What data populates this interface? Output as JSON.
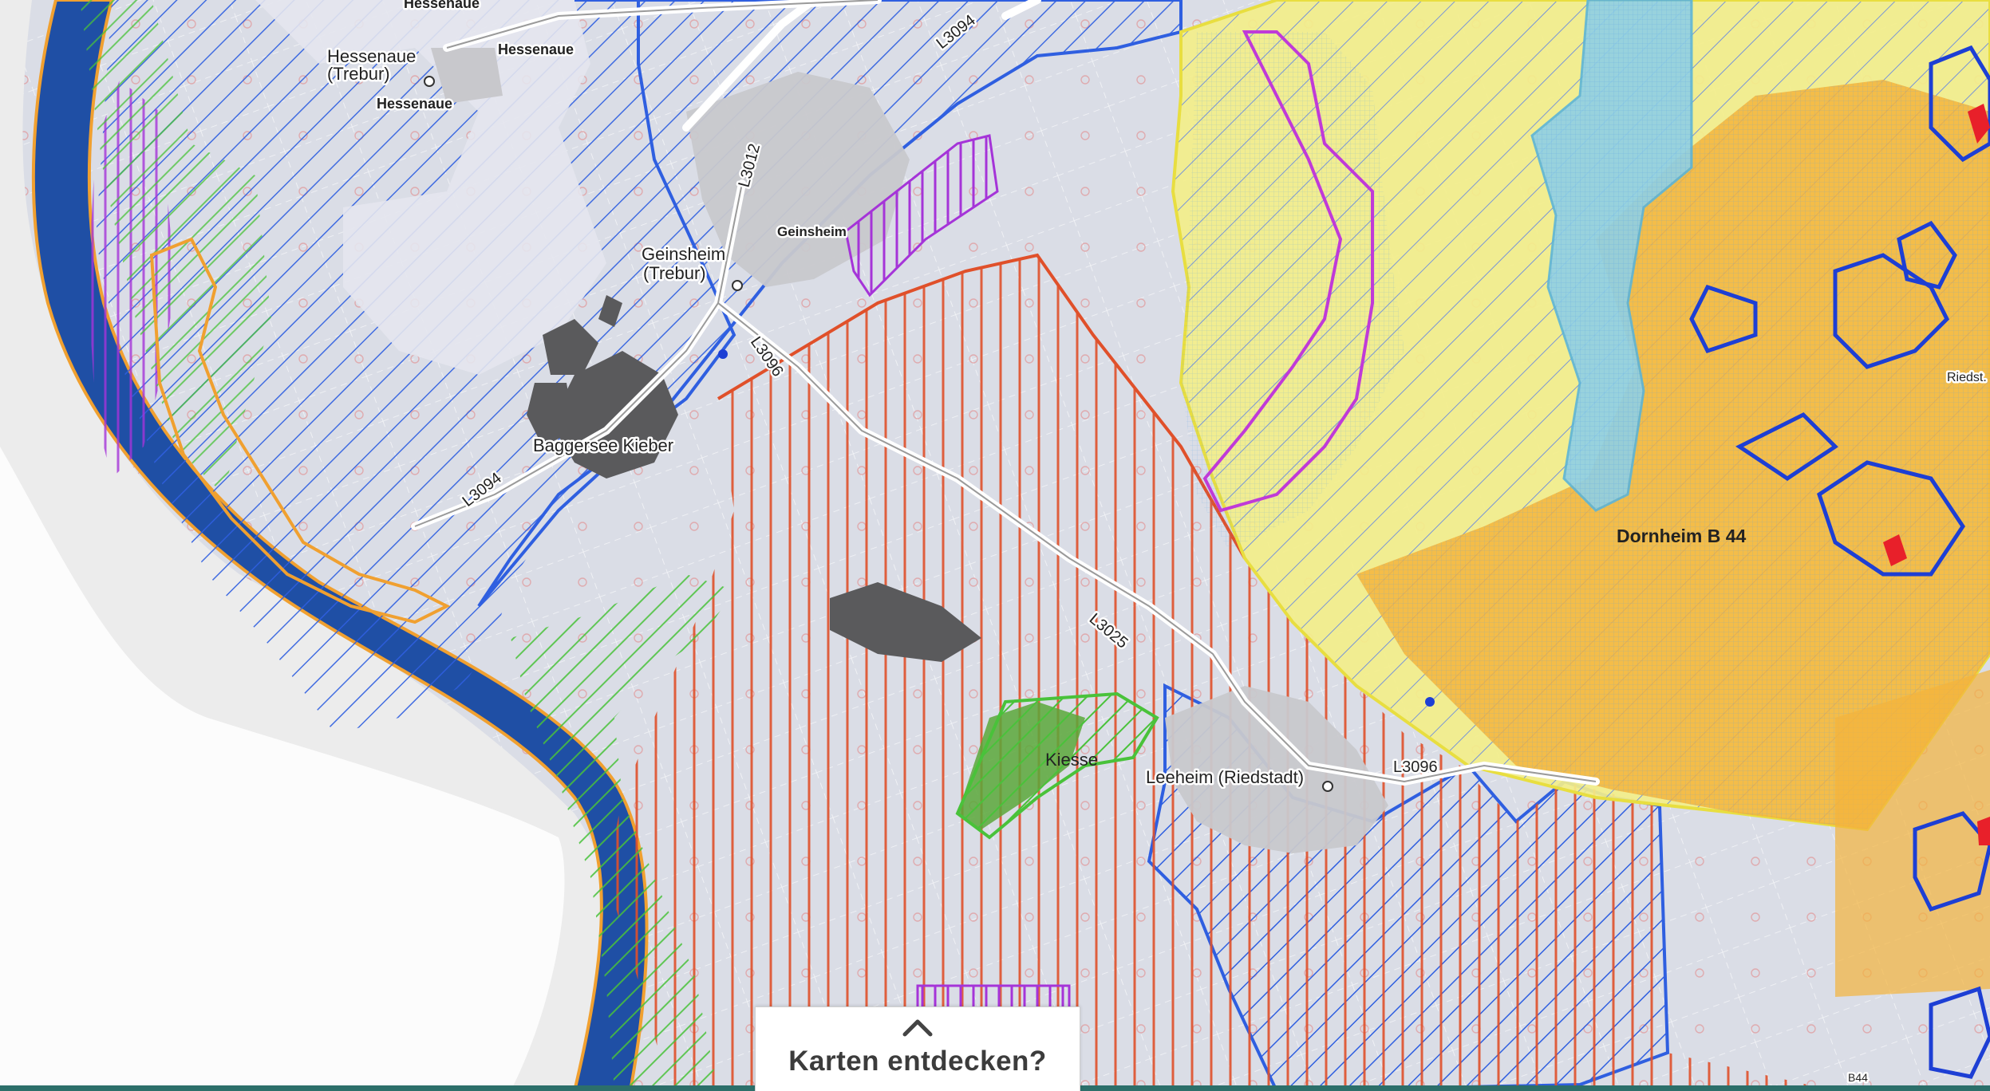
{
  "map": {
    "places": {
      "hessenaue_top": "Hessenaue",
      "hessenaue_trebur_1": "Hessenaue",
      "hessenaue_trebur_2": "(Trebur)",
      "hessenaue_mid": "Hessenaue",
      "hessenaue_small": "Hessenaue",
      "geinsheim_trebur_1": "Geinsheim",
      "geinsheim_trebur_2": "(Trebur)",
      "geinsheim": "Geinsheim",
      "baggersee": "Baggersee Kieber",
      "dornheim": "Dornheim B 44",
      "leeheim": "Leeheim (Riedstadt)",
      "riedstadt_fragment": "Riedst.",
      "kiessee": "Kiesse"
    },
    "roads": {
      "l3094_a": "L3094",
      "l3094_b": "L3094",
      "l3012": "L3012",
      "l3096": "L3096",
      "l3025": "L3025",
      "l3096_b": "L3096",
      "b44": "B44"
    }
  },
  "discover": {
    "label": "Karten entdecken?",
    "icon": "chevron-up-icon"
  },
  "colors": {
    "river": "#1f4fa5",
    "river_edge": "#f0a030",
    "blue_hatch": "#2f5fe0",
    "orange_hatch": "#e0502a",
    "yellow_area": "#f3ee8a",
    "orange_area": "#f4b43c",
    "cyan_area": "#8fd0e6",
    "green": "#49c23a",
    "purple": "#a534d8"
  }
}
